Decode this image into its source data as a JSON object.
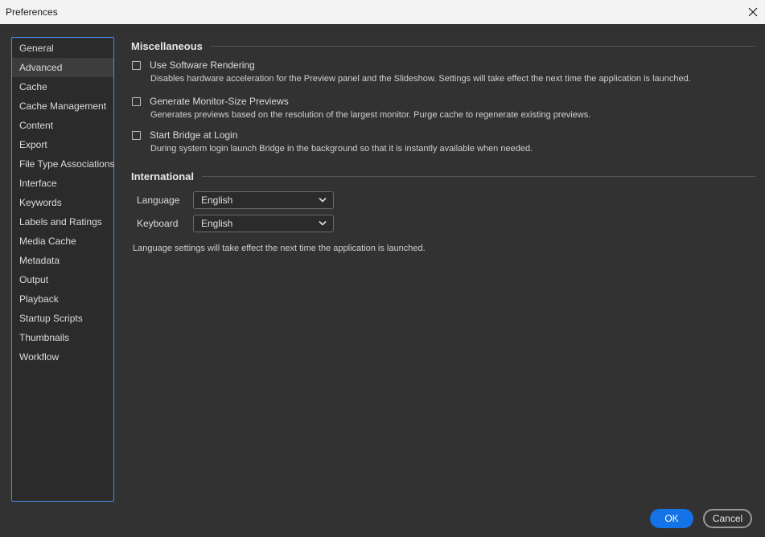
{
  "window": {
    "title": "Preferences"
  },
  "sidebar": {
    "items": [
      {
        "label": "General"
      },
      {
        "label": "Advanced"
      },
      {
        "label": "Cache"
      },
      {
        "label": "Cache Management"
      },
      {
        "label": "Content"
      },
      {
        "label": "Export"
      },
      {
        "label": "File Type Associations"
      },
      {
        "label": "Interface"
      },
      {
        "label": "Keywords"
      },
      {
        "label": "Labels and Ratings"
      },
      {
        "label": "Media Cache"
      },
      {
        "label": "Metadata"
      },
      {
        "label": "Output"
      },
      {
        "label": "Playback"
      },
      {
        "label": "Startup Scripts"
      },
      {
        "label": "Thumbnails"
      },
      {
        "label": "Workflow"
      }
    ],
    "selected": "Advanced"
  },
  "misc": {
    "title": "Miscellaneous",
    "options": [
      {
        "label": "Use Software Rendering",
        "description": "Disables hardware acceleration for the Preview panel and the Slideshow. Settings will take effect the next time the application is launched.",
        "checked": false
      },
      {
        "label": "Generate Monitor-Size Previews",
        "description": "Generates previews based on the resolution of the largest monitor.  Purge cache to regenerate existing previews.",
        "checked": false
      },
      {
        "label": "Start Bridge at Login",
        "description": "During system login launch Bridge in the background so that it is instantly available when needed.",
        "checked": false
      }
    ]
  },
  "international": {
    "title": "International",
    "language_label": "Language",
    "language_value": "English",
    "keyboard_label": "Keyboard",
    "keyboard_value": "English",
    "note": "Language settings will take effect the next time the application is launched."
  },
  "buttons": {
    "ok": "OK",
    "cancel": "Cancel"
  },
  "colors": {
    "accent": "#1473e6",
    "focus_border": "#4a8ef0",
    "background": "#323232"
  },
  "icons": {
    "close": "close-icon",
    "dropdown": "chevron-down-icon"
  }
}
